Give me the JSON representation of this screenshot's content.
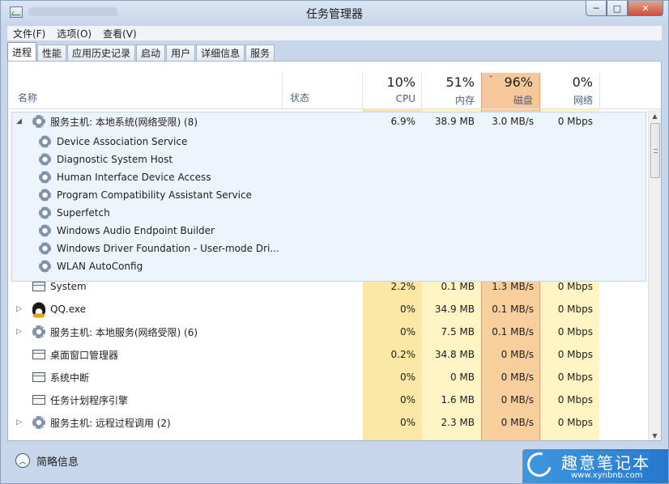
{
  "window": {
    "title": "任务管理器",
    "min_label": "─",
    "max_label": "□",
    "close_label": "✕"
  },
  "menu": [
    "文件(F)",
    "选项(O)",
    "查看(V)"
  ],
  "tabs": [
    "进程",
    "性能",
    "应用历史记录",
    "启动",
    "用户",
    "详细信息",
    "服务"
  ],
  "active_tab": "进程",
  "columns": {
    "name": "名称",
    "status": "状态",
    "cpu": {
      "percent": "10%",
      "label": "CPU"
    },
    "memory": {
      "percent": "51%",
      "label": "内存"
    },
    "disk": {
      "percent": "96%",
      "label": "磁盘"
    },
    "network": {
      "percent": "0%",
      "label": "网络"
    }
  },
  "sort_indicator": "ˇ",
  "processes": [
    {
      "name": "服务主机: 本地系统(网络受限) (8)",
      "cpu": "6.9%",
      "mem": "38.9 MB",
      "disk": "3.0 MB/s",
      "net": "0 Mbps",
      "icon": "gear-icon",
      "expand": "◢"
    },
    {
      "name": "Device Association Service",
      "icon": "gear-icon",
      "sub": true
    },
    {
      "name": "Diagnostic System Host",
      "icon": "gear-icon",
      "sub": true
    },
    {
      "name": "Human Interface Device Access",
      "icon": "gear-icon",
      "sub": true
    },
    {
      "name": "Program Compatibility Assistant Service",
      "icon": "gear-icon",
      "sub": true
    },
    {
      "name": "Superfetch",
      "icon": "gear-icon",
      "sub": true
    },
    {
      "name": "Windows Audio Endpoint Builder",
      "icon": "gear-icon",
      "sub": true
    },
    {
      "name": "Windows Driver Foundation - User-mode Dri...",
      "icon": "gear-icon",
      "sub": true
    },
    {
      "name": "WLAN AutoConfig",
      "icon": "gear-icon",
      "sub": true
    },
    {
      "name": "System",
      "cpu": "2.2%",
      "mem": "0.1 MB",
      "disk": "1.3 MB/s",
      "net": "0 Mbps",
      "icon": "window-icon"
    },
    {
      "name": "QQ.exe",
      "cpu": "0%",
      "mem": "34.9 MB",
      "disk": "0.1 MB/s",
      "net": "0 Mbps",
      "icon": "qq-icon",
      "expand": "▷"
    },
    {
      "name": "服务主机: 本地服务(网络受限) (6)",
      "cpu": "0%",
      "mem": "7.5 MB",
      "disk": "0.1 MB/s",
      "net": "0 Mbps",
      "icon": "gear-icon",
      "expand": "▷"
    },
    {
      "name": "桌面窗口管理器",
      "cpu": "0.2%",
      "mem": "34.8 MB",
      "disk": "0 MB/s",
      "net": "0 Mbps",
      "icon": "window-icon"
    },
    {
      "name": "系统中断",
      "cpu": "0%",
      "mem": "0 MB",
      "disk": "0 MB/s",
      "net": "0 Mbps",
      "icon": "window-icon"
    },
    {
      "name": "任务计划程序引擎",
      "cpu": "0%",
      "mem": "1.6 MB",
      "disk": "0 MB/s",
      "net": "0 Mbps",
      "icon": "window-icon"
    },
    {
      "name": "服务主机: 远程过程调用 (2)",
      "cpu": "0%",
      "mem": "2.3 MB",
      "disk": "0 MB/s",
      "net": "0 Mbps",
      "icon": "gear-icon",
      "expand": "▷"
    }
  ],
  "footer": {
    "fewer_details": "简略信息",
    "fewer_icon": "︿"
  },
  "watermark": {
    "text": "趣意笔记本",
    "url": "www.xynbnb.com"
  },
  "colors": {
    "disk_header": "#f6c79b",
    "disk_column": "#f8cf9c",
    "heat_light": "#fff4c4",
    "heat_medium": "#fbe8a6",
    "selection_group": "#eef4fb"
  }
}
